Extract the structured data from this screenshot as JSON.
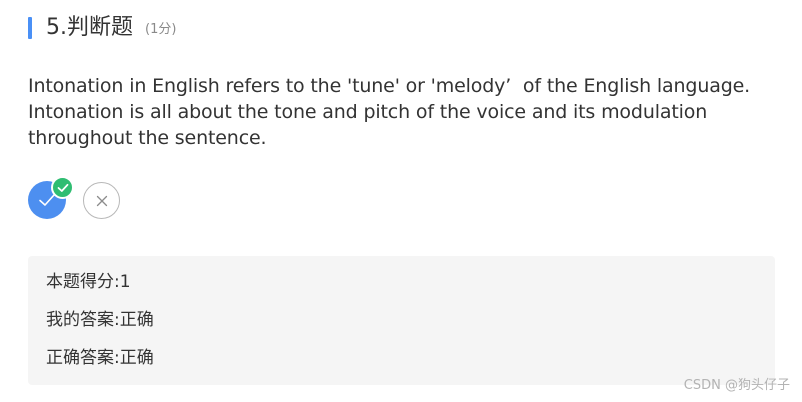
{
  "question": {
    "title": "5.判断题",
    "score": "(1分)",
    "text": "Intonation in English refers to the 'tune' or 'melody’  of the English language. Intonation is all about the tone and pitch of the voice and its modulation throughout the sentence."
  },
  "options": [
    {
      "name": "true",
      "icon": "check-icon",
      "selected": true,
      "correct": true
    },
    {
      "name": "false",
      "icon": "close-icon",
      "selected": false
    }
  ],
  "result": {
    "score_label": "本题得分:",
    "score_value": "1",
    "my_answer_label": "我的答案:",
    "my_answer_value": "正确",
    "correct_answer_label": "正确答案:",
    "correct_answer_value": "正确"
  },
  "watermark": "CSDN @狗头仔子",
  "colors": {
    "accent": "#4a90f6",
    "selected_option": "#4d8ff0",
    "correct_badge": "#2fbd72",
    "result_background": "#f5f5f5"
  }
}
